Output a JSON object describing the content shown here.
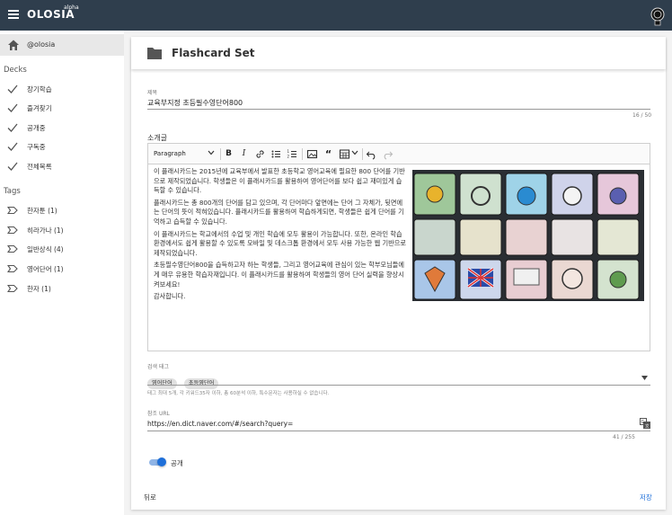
{
  "appbar": {
    "brand": "OLOSIA",
    "brand_sup": "alpha"
  },
  "sidebar": {
    "home_label": "@olosia",
    "decks_heading": "Decks",
    "decks": [
      "장기학습",
      "즐겨찾기",
      "공개중",
      "구독중",
      "전체목록"
    ],
    "tags_heading": "Tags",
    "tags": [
      "한자툰 (1)",
      "히라가나 (1)",
      "일반상식 (4)",
      "영어단어 (1)",
      "한자 (1)"
    ]
  },
  "card": {
    "title": "Flashcard Set",
    "title_field": {
      "label": "제목",
      "value": "교육부지정 초등필수영단어800",
      "counter": "16 / 50"
    },
    "intro_label": "소개글",
    "editor": {
      "paragraph_select": "Paragraph",
      "body": [
        "이 플래시카드는 2015년에 교육부에서 발표한 초등학교 영어교육에 필요한 800 단어를 기반으로 제작되었습니다. 학생들은 이 플래시카드를 활용하여 영어단어를 보다 쉽고 재미있게 습득할 수 있습니다.",
        "플래시카드는 총 800개의 단어를 담고 있으며, 각 단어마다 앞면에는 단어 그 자체가, 뒷면에는 단어의 뜻이 적혀있습니다. 플래시카드를 활용하여 학습하게되면, 학생들은 쉽게 단어를 기억하고 습득할 수 있습니다.",
        "이 플래시카드는 학교에서의 수업 및 개인 학습에 모두 활용이 가능합니다. 또한, 온라인 학습환경에서도 쉽게 활용할 수 있도록 모바일 및 데스크톱 환경에서 모두 사용 가능한 웹 기반으로 제작되었습니다.",
        "초등필수영단어800을 습득하고자 하는 학생들, 그리고 영어교육에 관심이 있는 학부모님들에게 매우 유용한 학습자재입니다. 이 플래시카드를 활용하여 학생들의 영어 단어 실력을 향상시켜보세요!",
        "감사합니다."
      ]
    },
    "search_tags": {
      "label": "검색 태그",
      "chips": [
        "영어단어",
        "초등영단어"
      ],
      "hint": "태그 최대 5개, 각 키워드35자 이하, 총 60분석 이하, 특수문자는 사용하실 수 없습니다."
    },
    "ref_url": {
      "label": "참조 URL",
      "value": "https://en.dict.naver.com/#/search?query=",
      "counter": "41 / 255"
    },
    "public_toggle": {
      "label": "공개",
      "on": true
    },
    "back_label": "뒤로",
    "save_label": "저장"
  },
  "colors": {
    "appbar": "#2f3e4d",
    "accent": "#1e6fd9"
  }
}
